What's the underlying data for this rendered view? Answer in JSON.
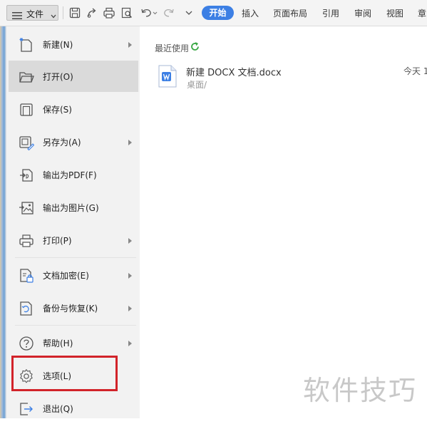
{
  "toolbar": {
    "file_label": "文件",
    "tabs": [
      "开始",
      "插入",
      "页面布局",
      "引用",
      "审阅",
      "视图",
      "章"
    ],
    "icons": [
      "save-icon",
      "export-icon",
      "print-icon",
      "preview-icon",
      "undo-icon",
      "redo-icon",
      "more-dropdown-icon"
    ]
  },
  "menu": {
    "items": [
      {
        "label": "新建(N)",
        "icon": "new-doc-icon",
        "submenu": true
      },
      {
        "label": "打开(O)",
        "icon": "folder-open-icon",
        "submenu": false
      },
      {
        "label": "保存(S)",
        "icon": "save-icon",
        "submenu": false
      },
      {
        "label": "另存为(A)",
        "icon": "save-as-icon",
        "submenu": true
      },
      {
        "label": "输出为PDF(F)",
        "icon": "pdf-export-icon",
        "submenu": false
      },
      {
        "label": "输出为图片(G)",
        "icon": "image-export-icon",
        "submenu": false
      },
      {
        "label": "打印(P)",
        "icon": "print-icon",
        "submenu": true
      },
      {
        "label": "文档加密(E)",
        "icon": "encrypt-icon",
        "submenu": true
      },
      {
        "label": "备份与恢复(K)",
        "icon": "backup-icon",
        "submenu": true
      },
      {
        "label": "帮助(H)",
        "icon": "help-icon",
        "submenu": true
      },
      {
        "label": "选项(L)",
        "icon": "settings-gear-icon",
        "submenu": false
      },
      {
        "label": "退出(Q)",
        "icon": "exit-icon",
        "submenu": false
      }
    ],
    "active_index": 1,
    "highlighted_index": 10
  },
  "recent": {
    "title": "最近使用",
    "files": [
      {
        "name": "新建 DOCX 文档.docx",
        "path": "桌面/",
        "time": "今天 1"
      }
    ]
  },
  "watermark": "软件技巧",
  "colors": {
    "accent": "#3c7fe4",
    "highlight_border": "#d2232a",
    "active_item": "#dadada",
    "refresh_green": "#3aa845"
  }
}
